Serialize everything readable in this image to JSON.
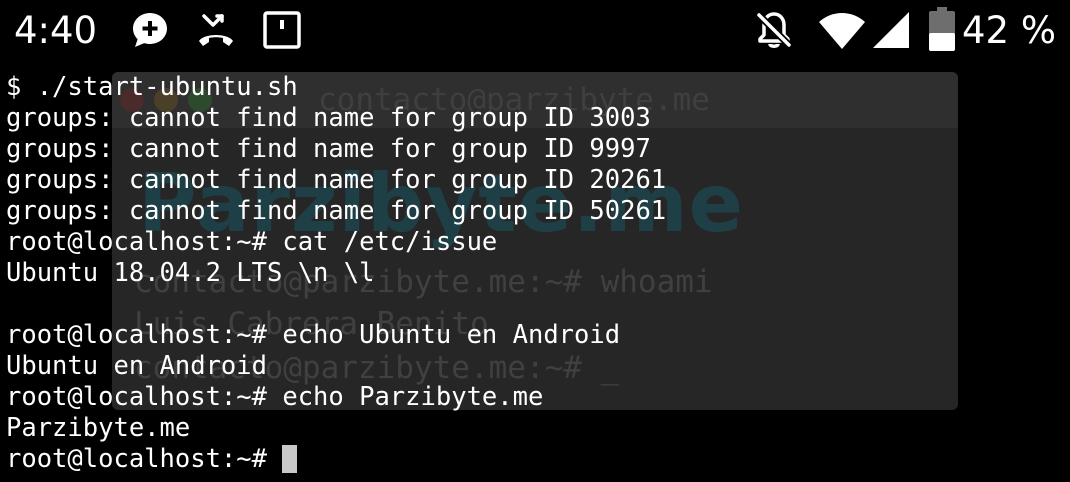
{
  "status_bar": {
    "time": "4:40",
    "battery_percent": "42 %",
    "icons": [
      "chat-bubble-add-icon",
      "missed-call-icon",
      "app-notification-icon",
      "notifications-off-icon",
      "wifi-icon",
      "cellular-signal-icon",
      "battery-icon"
    ]
  },
  "watermark": {
    "title": "contacto@parzibyte.me",
    "brand": "Parzibyte.me",
    "lines": [
      "contacto@parzibyte.me:~# whoami",
      "Luis Cabrera Benito",
      "contacto@parzibyte.me:~# _"
    ]
  },
  "terminal": {
    "lines": [
      "$ ./start-ubuntu.sh",
      "groups: cannot find name for group ID 3003",
      "groups: cannot find name for group ID 9997",
      "groups: cannot find name for group ID 20261",
      "groups: cannot find name for group ID 50261",
      "root@localhost:~# cat /etc/issue",
      "Ubuntu 18.04.2 LTS \\n \\l",
      "",
      "root@localhost:~# echo Ubuntu en Android",
      "Ubuntu en Android",
      "root@localhost:~# echo Parzibyte.me",
      "Parzibyte.me"
    ],
    "prompt": "root@localhost:~# "
  },
  "colors": {
    "background": "#000000",
    "foreground": "#ffffff",
    "cursor": "#c8c8c8"
  }
}
